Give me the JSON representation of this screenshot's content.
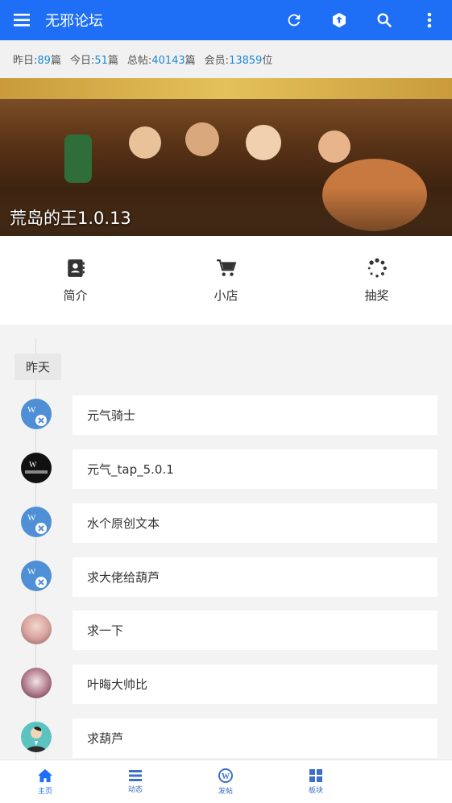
{
  "app": {
    "title": "无邪论坛"
  },
  "toolbar": {
    "refresh_icon": "refresh-icon",
    "upload_icon": "upload-icon",
    "search_icon": "search-icon",
    "more_icon": "more-icon"
  },
  "stats": [
    {
      "label": "昨日:",
      "value": "89",
      "unit": "篇"
    },
    {
      "label": "今日:",
      "value": "51",
      "unit": "篇"
    },
    {
      "label": "总帖:",
      "value": "40143",
      "unit": "篇"
    },
    {
      "label": "会员:",
      "value": "13859",
      "unit": "位"
    }
  ],
  "banner": {
    "caption": "荒岛的王1.0.13"
  },
  "quick": [
    {
      "label": "简介",
      "icon": "contacts-icon"
    },
    {
      "label": "小店",
      "icon": "cart-icon"
    },
    {
      "label": "抽奖",
      "icon": "spinner-icon"
    }
  ],
  "timeline": {
    "day_label": "昨天",
    "posts": [
      {
        "title": "元气骑士",
        "avatar": "wx-avatar"
      },
      {
        "title": "元气_tap_5.0.1",
        "avatar": "dark-avatar"
      },
      {
        "title": "水个原创文本",
        "avatar": "wx-avatar"
      },
      {
        "title": "求大佬给葫芦",
        "avatar": "wx-avatar"
      },
      {
        "title": "求一下",
        "avatar": "anime-girl-avatar"
      },
      {
        "title": "叶晦大帅比",
        "avatar": "anime-character-avatar"
      },
      {
        "title": "求葫芦",
        "avatar": "person-avatar"
      }
    ]
  },
  "bottom_nav": [
    {
      "label": "主页",
      "icon": "home-icon",
      "active": true
    },
    {
      "label": "动态",
      "icon": "list-icon"
    },
    {
      "label": "发帖",
      "icon": "wordpress-icon"
    },
    {
      "label": "板块",
      "icon": "grid-icon"
    }
  ],
  "colors": {
    "primary": "#1e6ff5",
    "stat_number": "#1e88d8"
  }
}
